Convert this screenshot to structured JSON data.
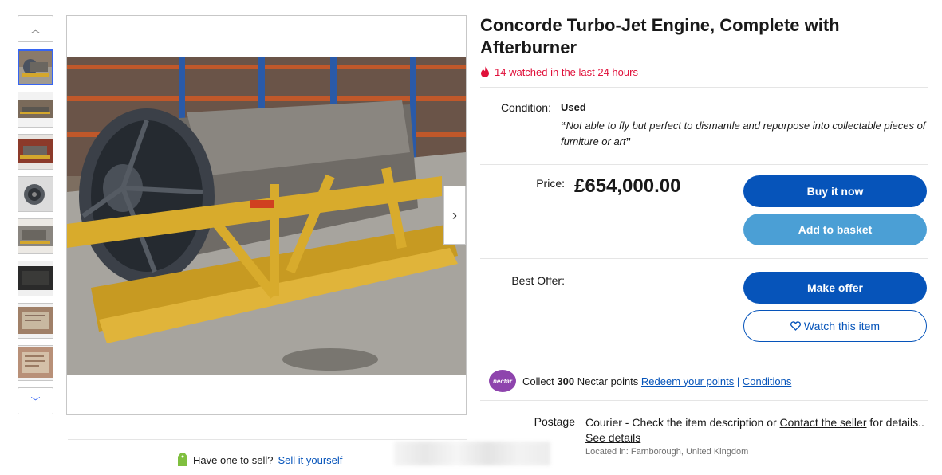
{
  "listing": {
    "title": "Concorde Turbo-Jet Engine, Complete with Afterburner",
    "watched_text": "14 watched in the last 24 hours"
  },
  "condition": {
    "label": "Condition:",
    "value": "Used",
    "quote": "Not able to fly but perfect to dismantle and repurpose into collectable pieces of furniture or art"
  },
  "price": {
    "label": "Price:",
    "value": "£654,000.00"
  },
  "buttons": {
    "buy_now": "Buy it now",
    "add_to_basket": "Add to basket",
    "make_offer": "Make offer",
    "watch_item": "Watch this item"
  },
  "best_offer": {
    "label": "Best Offer:"
  },
  "nectar": {
    "logo_text": "nectar",
    "collect_prefix": "Collect",
    "points": "300",
    "collect_suffix": "Nectar points",
    "redeem_link": "Redeem your points",
    "separator": "|",
    "conditions_link": "Conditions"
  },
  "postage": {
    "label": "Postage",
    "text_before": "Courier - Check the item description or",
    "contact_link": "Contact the seller",
    "text_after": "for details..",
    "see_details_link": "See details",
    "location": "Located in: Farnborough, United Kingdom"
  },
  "sell": {
    "prompt": "Have one to sell?",
    "link": "Sell it yourself"
  },
  "icons": {
    "fire": "fire-icon",
    "heart": "heart-icon",
    "tag": "tag-icon",
    "chevron_up": "chevron-up-icon",
    "chevron_down": "chevron-down-icon",
    "chevron_right": "chevron-right-icon"
  },
  "colors": {
    "primary_blue": "#0654ba",
    "secondary_blue": "#4b9fd5",
    "watched_red": "#e0103a",
    "nectar_purple": "#8e44ad",
    "active_thumb_border": "#3665f3"
  },
  "gallery": {
    "thumbnail_count": 8,
    "active_index": 0
  }
}
